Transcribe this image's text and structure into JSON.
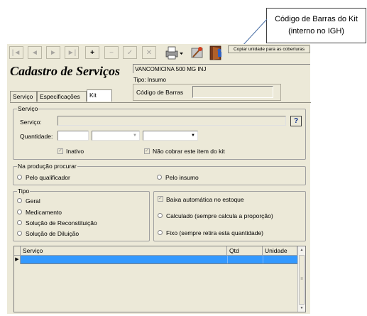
{
  "callout": {
    "text": "Código de Barras do Kit (interno no IGH)"
  },
  "toolbar": {
    "buttons": [
      {
        "icon": "first-icon",
        "glyph": "|◄"
      },
      {
        "icon": "prev-icon",
        "glyph": "◄"
      },
      {
        "icon": "next-icon",
        "glyph": "►"
      },
      {
        "icon": "last-icon",
        "glyph": "►|"
      },
      {
        "icon": "plus-icon",
        "glyph": "+"
      },
      {
        "icon": "minus-icon",
        "glyph": "−"
      },
      {
        "icon": "check-icon",
        "glyph": "✓"
      },
      {
        "icon": "cancel-icon",
        "glyph": "✕"
      }
    ],
    "copy_label": "Copiar unidade para as coberturas"
  },
  "header": {
    "title": "Cadastro de Serviços",
    "product": "VANCOMICINA 500 MG INJ",
    "tipo": "Tipo: Insumo",
    "barcode_label": "Código de Barras",
    "barcode_value": ""
  },
  "tabs": [
    {
      "label": "Serviço"
    },
    {
      "label": "Especificações"
    },
    {
      "label": "Kit"
    }
  ],
  "servico_group": {
    "legend": "Serviço",
    "servico_label": "Serviço:",
    "quantidade_label": "Quantidade:",
    "inativo_label": "Inativo",
    "nao_cobrar_label": "Não cobrar este item do kit",
    "help_glyph": "?"
  },
  "producao_group": {
    "legend": "Na produção procurar",
    "option1": "Pelo qualificador",
    "option2": "Pelo insumo"
  },
  "tipo_group": {
    "legend": "Tipo",
    "options": [
      "Geral",
      "Medicamento",
      "Solução de Reconstituição",
      "Solução de Diluição"
    ]
  },
  "baixa_group": {
    "baixa_label": "Baixa automática no estoque",
    "calc_label": "Calculado (sempre calcula a proporção)",
    "fixo_label": "Fixo (sempre retira esta quantidade)"
  },
  "grid": {
    "columns": [
      "Serviço",
      "Qtd",
      "Unidade"
    ],
    "row_marker": "▶",
    "selected_color": "#3399ff"
  }
}
